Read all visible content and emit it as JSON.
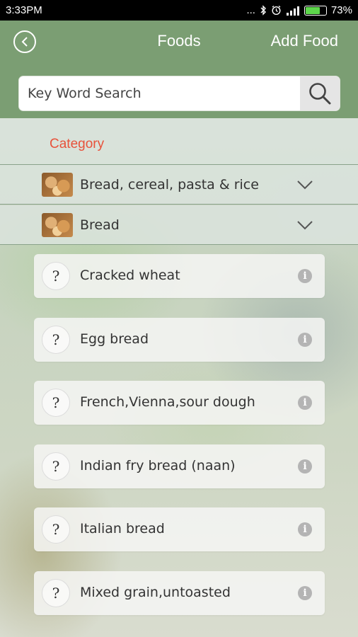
{
  "status_bar": {
    "time": "3:33PM",
    "indicators": "...",
    "battery_percent": "73%",
    "battery_level": 0.73
  },
  "header": {
    "title": "Foods",
    "add_food_label": "Add Food",
    "accent_color": "#7b9e73"
  },
  "search": {
    "placeholder": "Key Word Search",
    "value": ""
  },
  "category": {
    "label": "Category",
    "label_color": "#e8523b"
  },
  "groups": [
    {
      "label": "Bread, cereal, pasta & rice",
      "icon": "bread-thumbnail"
    },
    {
      "label": "Bread",
      "icon": "bread-thumbnail"
    }
  ],
  "foods": [
    {
      "label": "Cracked wheat",
      "badge": "?"
    },
    {
      "label": "Egg bread",
      "badge": "?"
    },
    {
      "label": "French,Vienna,sour dough",
      "badge": "?"
    },
    {
      "label": "Indian fry bread (naan)",
      "badge": "?"
    },
    {
      "label": "Italian bread",
      "badge": "?"
    },
    {
      "label": "Mixed grain,untoasted",
      "badge": "?"
    }
  ]
}
